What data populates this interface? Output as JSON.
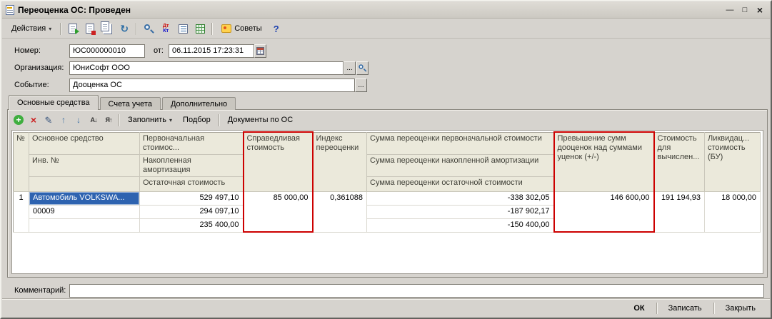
{
  "window": {
    "title": "Переоценка ОС: Проведен"
  },
  "icons": {
    "dropdown": "▾",
    "minimize": "—",
    "maximize": "□",
    "close": "×",
    "help": "?",
    "reread": "↻",
    "dt": "Дт",
    "kt": "Кт",
    "add": "+",
    "delete": "×",
    "edit": "✎",
    "move_up": "↑",
    "move_down": "↓",
    "sort_asc": "А↓",
    "sort_desc": "Я↑",
    "ellipsis": "..."
  },
  "toolbar": {
    "actions_label": "Действия",
    "tips_label": "Советы"
  },
  "form": {
    "number_label": "Номер:",
    "number_value": "ЮС000000010",
    "date_label": "от:",
    "date_value": "06.11.2015 17:23:31",
    "organization_label": "Организация:",
    "organization_value": "ЮниСофт ООО",
    "event_label": "Событие:",
    "event_value": "Дооценка ОС"
  },
  "tabs": {
    "items": [
      {
        "label": "Основные средства",
        "active": true
      },
      {
        "label": "Счета учета",
        "active": false
      },
      {
        "label": "Дополнительно",
        "active": false
      }
    ]
  },
  "table_toolbar": {
    "fill_label": "Заполнить",
    "pick_label": "Подбор",
    "docs_label": "Документы по ОС"
  },
  "table": {
    "headers": {
      "num": "№",
      "asset1": "Основное средство",
      "asset2": "Инв. №",
      "cost1": "Первоначальная стоимос...",
      "cost2": "Накопленная амортизация",
      "cost3": "Остаточная стоимость",
      "fair": "Справедливая стоимость",
      "index": "Индекс переоценки",
      "reval1": "Сумма переоценки первоначальной стоимости",
      "reval2": "Сумма переоценки накопленной амортизации",
      "reval3": "Сумма переоценки остаточной стоимости",
      "excess": "Превышение сумм дооценок над суммами уценок (+/-)",
      "calc": "Стоимость для вычислен...",
      "liquid": "Ликвидац... стоимость (БУ)"
    },
    "rows": [
      {
        "num": "1",
        "asset": "Автомобиль VOLKSWA...",
        "inv": "00009",
        "initial_cost": "529 497,10",
        "accum_depr": "294 097,10",
        "residual": "235 400,00",
        "fair_value": "85 000,00",
        "index": "0,361088",
        "reval_initial": "-338 302,05",
        "reval_depr": "-187 902,17",
        "reval_residual": "-150 400,00",
        "excess": "146 600,00",
        "calc_cost": "191 194,93",
        "liquidation": "18 000,00"
      }
    ]
  },
  "footer": {
    "comment_label": "Комментарий:",
    "comment_value": "",
    "ok_label": "ОК",
    "save_label": "Записать",
    "close_label": "Закрыть"
  },
  "colors": {
    "highlight_red": "#cc0000",
    "selection_blue": "#2e63b0",
    "header_bg": "#ebe9db",
    "window_bg": "#d6d3ce"
  }
}
